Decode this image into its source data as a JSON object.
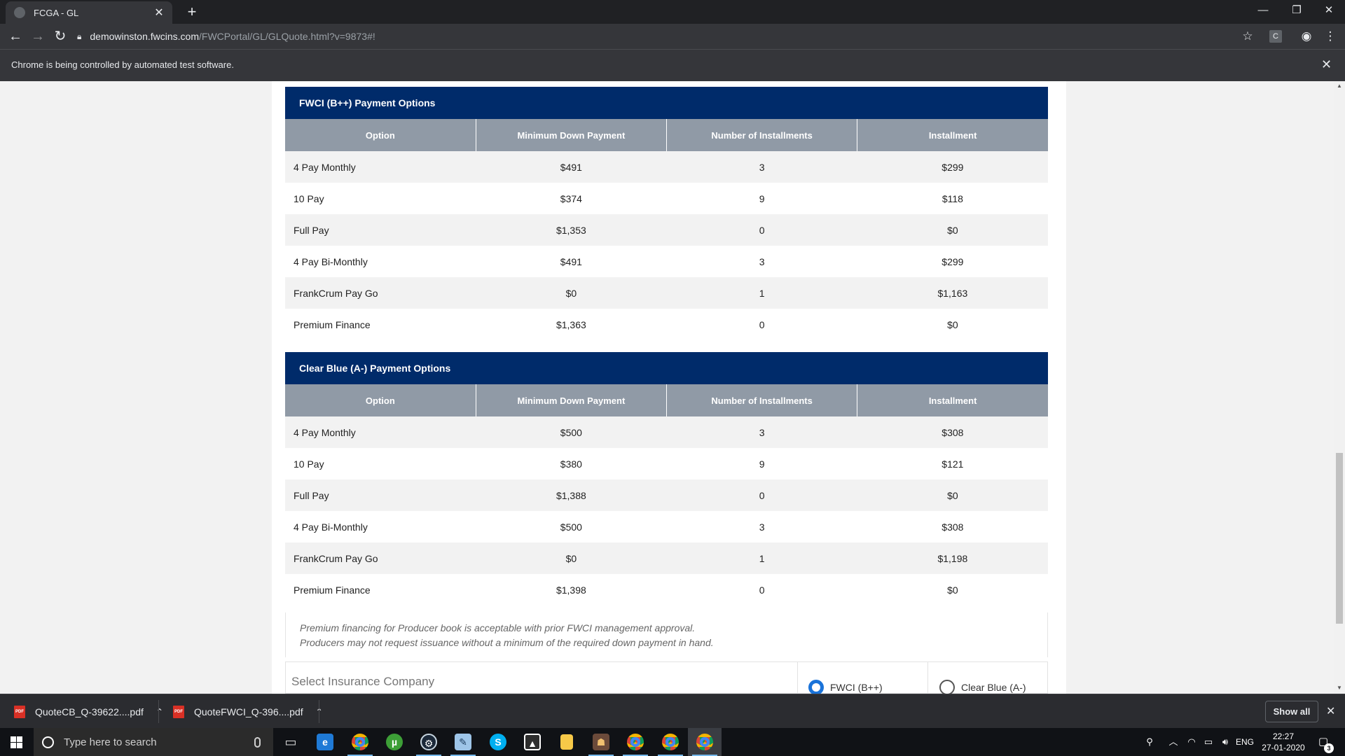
{
  "browser": {
    "tab_title": "FCGA - GL",
    "new_tab": "+",
    "url_host": "demowinston.fwcins.com",
    "url_path": "/FWCPortal/GL/GLQuote.html?v=9873#!",
    "infobar_text": "Chrome is being controlled by automated test software.",
    "extension_label": "C"
  },
  "icons": {
    "back": "arrow-left-icon",
    "forward": "arrow-right-icon",
    "reload": "reload-icon",
    "lock": "lock-icon",
    "star": "star-icon",
    "profile": "account-circle-icon",
    "menu": "kebab-menu-icon"
  },
  "colors": {
    "panel_header": "#002b6a",
    "column_header": "#909aa6",
    "radio_selected": "#1a73d9"
  },
  "fwci_panel": {
    "title": "FWCI (B++) Payment Options",
    "columns": [
      "Option",
      "Minimum Down Payment",
      "Number of Installments",
      "Installment"
    ],
    "rows": [
      [
        "4 Pay Monthly",
        "$491",
        "3",
        "$299"
      ],
      [
        "10 Pay",
        "$374",
        "9",
        "$118"
      ],
      [
        "Full Pay",
        "$1,353",
        "0",
        "$0"
      ],
      [
        "4 Pay Bi-Monthly",
        "$491",
        "3",
        "$299"
      ],
      [
        "FrankCrum Pay Go",
        "$0",
        "1",
        "$1,163"
      ],
      [
        "Premium Finance",
        "$1,363",
        "0",
        "$0"
      ]
    ]
  },
  "clearblue_panel": {
    "title": "Clear Blue (A-) Payment Options",
    "columns": [
      "Option",
      "Minimum Down Payment",
      "Number of Installments",
      "Installment"
    ],
    "rows": [
      [
        "4 Pay Monthly",
        "$500",
        "3",
        "$308"
      ],
      [
        "10 Pay",
        "$380",
        "9",
        "$121"
      ],
      [
        "Full Pay",
        "$1,388",
        "0",
        "$0"
      ],
      [
        "4 Pay Bi-Monthly",
        "$500",
        "3",
        "$308"
      ],
      [
        "FrankCrum Pay Go",
        "$0",
        "1",
        "$1,198"
      ],
      [
        "Premium Finance",
        "$1,398",
        "0",
        "$0"
      ]
    ]
  },
  "note": {
    "line1": "Premium financing for Producer book is acceptable with prior FWCI management approval.",
    "line2": "Producers may not request issuance without a minimum of the required down payment in hand."
  },
  "insurance_select": {
    "label": "Select Insurance Company",
    "option_fwci": "FWCI (B++)",
    "option_clearblue": "Clear Blue (A-)",
    "selected": "FWCI (B++)"
  },
  "downloads": {
    "items": [
      {
        "name": "QuoteCB_Q-39622....pdf",
        "icon": "pdf-icon"
      },
      {
        "name": "QuoteFWCI_Q-396....pdf",
        "icon": "pdf-icon"
      }
    ],
    "pdf_badge": "PDF",
    "show_all": "Show all"
  },
  "taskbar": {
    "search_placeholder": "Type here to search",
    "apps": [
      "task-view-icon",
      "edge-icon",
      "chrome-icon",
      "utorrent-icon",
      "steam-icon",
      "notepad-icon",
      "skype-icon",
      "photos-icon",
      "file-explorer-icon",
      "game-icon",
      "chrome-icon",
      "chrome-icon",
      "chrome-icon"
    ],
    "skype_letter": "S",
    "language": "ENG",
    "time": "22:27",
    "date": "27-01-2020",
    "notification_count": "3"
  }
}
